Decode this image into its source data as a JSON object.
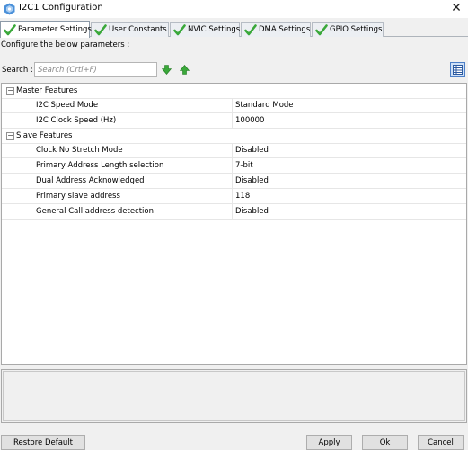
{
  "window": {
    "title": "I2C1 Configuration",
    "close_glyph": "✕",
    "icon": "gear-hex-icon"
  },
  "tabs": [
    {
      "label": "Parameter Settings",
      "active": true,
      "icon": "check-icon"
    },
    {
      "label": "User Constants",
      "active": false,
      "icon": "check-icon"
    },
    {
      "label": "NVIC Settings",
      "active": false,
      "icon": "check-icon"
    },
    {
      "label": "DMA Settings",
      "active": false,
      "icon": "check-icon"
    },
    {
      "label": "GPIO Settings",
      "active": false,
      "icon": "check-icon"
    }
  ],
  "configure_label": "Configure the below parameters :",
  "search": {
    "label": "Search :",
    "placeholder": "Search (Crtl+F)",
    "value": ""
  },
  "tree": {
    "groups": [
      {
        "label": "Master Features",
        "expanded": true,
        "toggle": "−",
        "params": [
          {
            "name": "I2C Speed Mode",
            "value": "Standard Mode"
          },
          {
            "name": "I2C Clock Speed (Hz)",
            "value": "100000"
          }
        ]
      },
      {
        "label": "Slave Features",
        "expanded": true,
        "toggle": "−",
        "params": [
          {
            "name": "Clock No Stretch Mode",
            "value": "Disabled"
          },
          {
            "name": "Primary Address Length selection",
            "value": "7-bit"
          },
          {
            "name": "Dual Address Acknowledged",
            "value": "Disabled"
          },
          {
            "name": "Primary slave address",
            "value": "118"
          },
          {
            "name": "General Call address detection",
            "value": "Disabled"
          }
        ]
      }
    ]
  },
  "buttons": {
    "restore_default": "Restore Default",
    "apply": "Apply",
    "ok": "Ok",
    "cancel": "Cancel"
  },
  "colors": {
    "accent_blue": "#4d7fc7",
    "check_green": "#3aa83a",
    "title_icon": "#4a90d9"
  }
}
